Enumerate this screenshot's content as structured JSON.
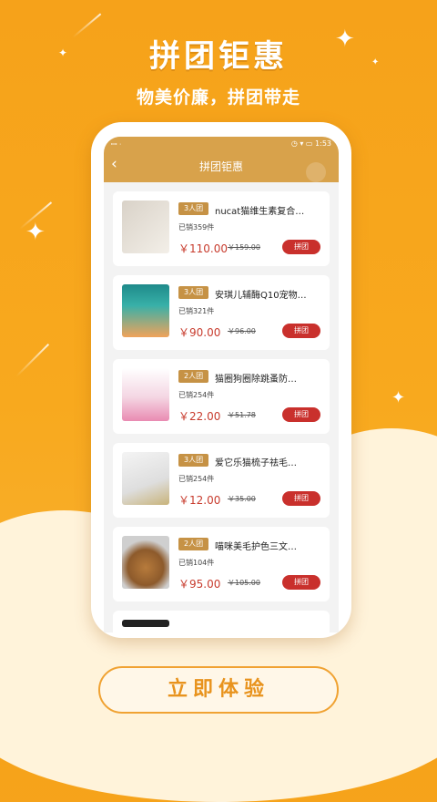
{
  "promo": {
    "headline": "拼团钜惠",
    "subheadline": "物美价廉，拼团带走",
    "cta_label": "立即体验"
  },
  "app": {
    "status": {
      "left": "ꟷ ᐧ",
      "time": "1:53",
      "right_prefix": "◷ ▾ ▭"
    },
    "nav": {
      "back_icon": "chevron-left-icon",
      "title": "拼团钜惠"
    },
    "items": [
      {
        "badge": "3人团",
        "name": "nucat猫维生素复合…",
        "sold": "已销359件",
        "price": "￥110.00",
        "original": "￥159.00",
        "button": "拼团"
      },
      {
        "badge": "3人团",
        "name": "安琪儿辅酶Q10宠物…",
        "sold": "已销321件",
        "price": "￥90.00",
        "original": "￥96.00",
        "button": "拼团"
      },
      {
        "badge": "2人团",
        "name": "猫圈狗圈除跳蚤防…",
        "sold": "已销254件",
        "price": "￥22.00",
        "original": "￥51.78",
        "button": "拼团"
      },
      {
        "badge": "3人团",
        "name": "爱它乐猫梳子祛毛…",
        "sold": "已销254件",
        "price": "￥12.00",
        "original": "￥35.00",
        "button": "拼团"
      },
      {
        "badge": "2人团",
        "name": "喵咪美毛护色三文…",
        "sold": "已销104件",
        "price": "￥95.00",
        "original": "￥105.00",
        "button": "拼团"
      }
    ]
  }
}
